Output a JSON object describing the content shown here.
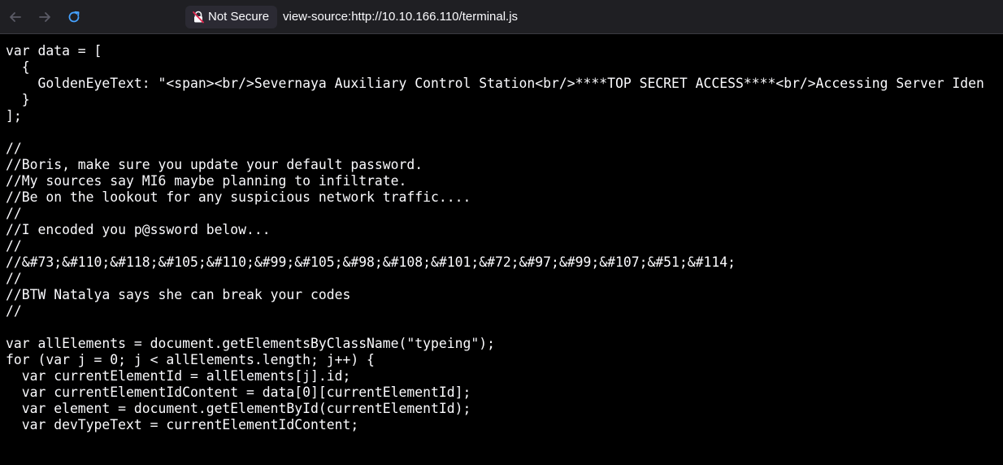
{
  "browser": {
    "security_label": "Not Secure",
    "url": "view-source:http://10.10.166.110/terminal.js",
    "icons": {
      "back": "arrow-left-icon",
      "forward": "arrow-right-icon",
      "reload": "reload-icon",
      "lock": "lock-warning-icon"
    },
    "colors": {
      "toolbar": "#1f1f23",
      "text": "#fbfbfe",
      "disabled_icon": "#5b5b66",
      "reload_icon": "#45a1ff",
      "warning": "#e22850"
    }
  },
  "source": {
    "lines": [
      "var data = [",
      "  {",
      "    GoldenEyeText: \"<span><br/>Severnaya Auxiliary Control Station<br/>****TOP SECRET ACCESS****<br/>Accessing Server Iden",
      "  }",
      "];",
      "",
      "//",
      "//Boris, make sure you update your default password.",
      "//My sources say MI6 maybe planning to infiltrate.",
      "//Be on the lookout for any suspicious network traffic....",
      "//",
      "//I encoded you p@ssword below...",
      "//",
      "//&#73;&#110;&#118;&#105;&#110;&#99;&#105;&#98;&#108;&#101;&#72;&#97;&#99;&#107;&#51;&#114;",
      "//",
      "//BTW Natalya says she can break your codes",
      "//",
      "",
      "var allElements = document.getElementsByClassName(\"typeing\");",
      "for (var j = 0; j < allElements.length; j++) {",
      "  var currentElementId = allElements[j].id;",
      "  var currentElementIdContent = data[0][currentElementId];",
      "  var element = document.getElementById(currentElementId);",
      "  var devTypeText = currentElementIdContent;"
    ]
  }
}
